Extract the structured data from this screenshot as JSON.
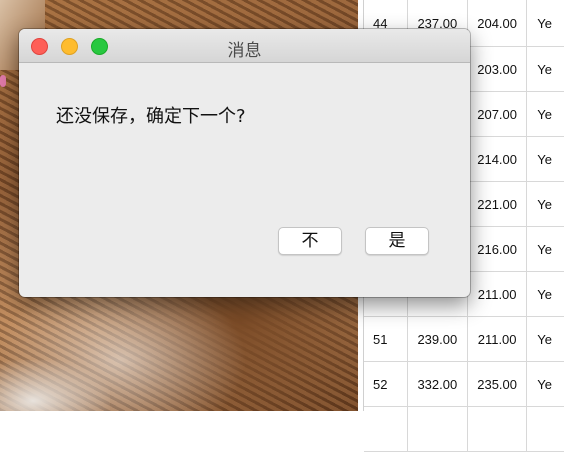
{
  "dialog": {
    "title": "消息",
    "message": "还没保存，确定下一个?",
    "buttons": {
      "no": "不",
      "yes": "是"
    }
  },
  "table": {
    "rows": [
      [
        "44",
        "237.00",
        "204.00",
        "Ye"
      ],
      [
        "",
        "",
        "203.00",
        "Ye"
      ],
      [
        "",
        "",
        "207.00",
        "Ye"
      ],
      [
        "",
        "",
        "214.00",
        "Ye"
      ],
      [
        "",
        "",
        "221.00",
        "Ye"
      ],
      [
        "",
        "",
        "216.00",
        "Ye"
      ],
      [
        "",
        "",
        "211.00",
        "Ye"
      ],
      [
        "51",
        "239.00",
        "211.00",
        "Ye"
      ],
      [
        "52",
        "332.00",
        "235.00",
        "Ye"
      ],
      [
        "",
        "",
        "",
        ""
      ]
    ]
  }
}
